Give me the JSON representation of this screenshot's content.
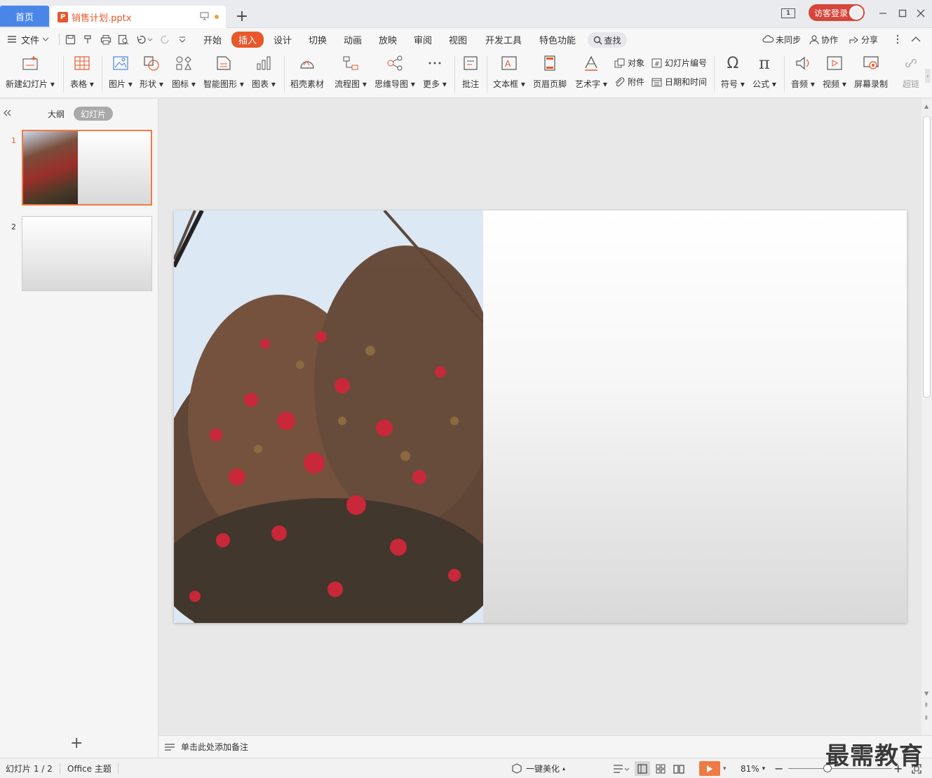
{
  "tabs": {
    "home": "首页",
    "doc_name": "销售计划.pptx",
    "doc_badge": "P",
    "new_tab": "+"
  },
  "window": {
    "login": "访客登录",
    "page_indicator": "1"
  },
  "menu": {
    "file": "文件",
    "items": [
      "开始",
      "插入",
      "设计",
      "切换",
      "动画",
      "放映",
      "审阅",
      "视图",
      "开发工具",
      "特色功能"
    ],
    "active": "插入",
    "search": "查找",
    "sync": "未同步",
    "collab": "协作",
    "share": "分享"
  },
  "ribbon": {
    "new_slide": "新建幻灯片",
    "table": "表格",
    "picture": "图片",
    "shape": "形状",
    "icon": "图标",
    "smart_art": "智能图形",
    "chart": "图表",
    "material": "稻壳素材",
    "flowchart": "流程图",
    "mindmap": "思维导图",
    "more": "更多",
    "comment": "批注",
    "textbox": "文本框",
    "header_footer": "页眉页脚",
    "wordart": "艺术字",
    "object": "对象",
    "slide_number": "幻灯片编号",
    "attachment": "附件",
    "datetime": "日期和时间",
    "symbol": "符号",
    "formula": "公式",
    "audio": "音频",
    "video": "视频",
    "screen_record": "屏幕录制",
    "hyperlink": "超链"
  },
  "leftpanel": {
    "outline": "大纲",
    "slides": "幻灯片",
    "slide_numbers": [
      "1",
      "2"
    ],
    "add": "+"
  },
  "notes": {
    "placeholder": "单击此处添加备注"
  },
  "status": {
    "slide_info": "幻灯片 1 / 2",
    "theme": "Office 主题",
    "beautify": "一键美化",
    "zoom": "81%"
  },
  "watermark": "最需教育",
  "colors": {
    "accent": "#e8582a",
    "home_tab": "#4a86e8",
    "login": "#d6463a",
    "play": "#f07a44"
  }
}
